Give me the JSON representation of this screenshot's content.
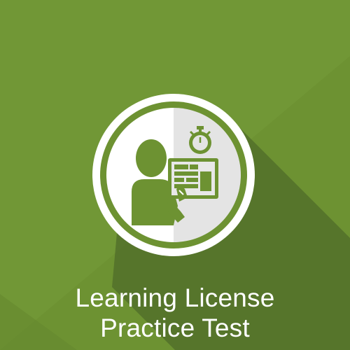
{
  "app": {
    "title_line_1": "Learning License",
    "title_line_2": "Practice Test"
  },
  "icons": {
    "main": "person-with-timed-test-icon",
    "person": "person-icon",
    "form": "test-form-icon",
    "timer": "stopwatch-icon"
  },
  "colors": {
    "background": "#6d9232",
    "background_light": "#729837",
    "shadow": "#4f6c25",
    "ring": "#ffffff",
    "inner_left": "#ffffff",
    "inner_right": "#e6e6e6",
    "glyph": "#6d9232",
    "text": "#ffffff"
  }
}
